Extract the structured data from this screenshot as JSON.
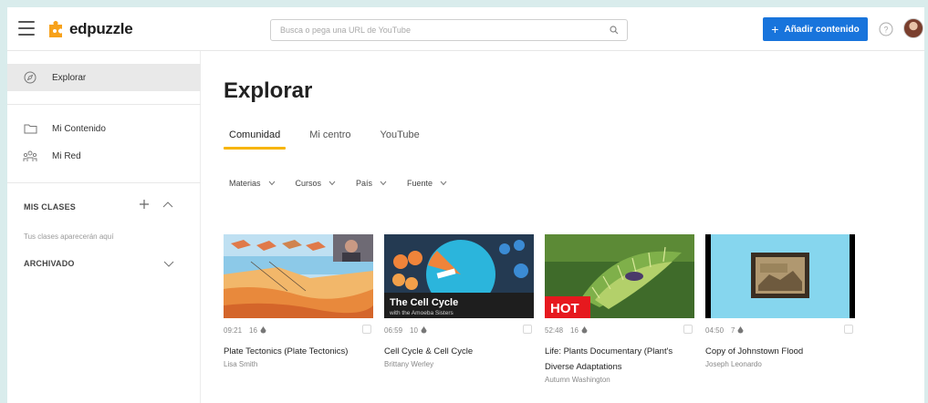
{
  "header": {
    "logo_text": "edpuzzle",
    "search_placeholder": "Busca o pega una URL de YouTube",
    "add_button_label": "Añadir contenido",
    "help_icon": "help-circle-icon"
  },
  "sidebar": {
    "items": [
      {
        "label": "Explorar",
        "icon": "compass-icon"
      },
      {
        "label": "Mi Contenido",
        "icon": "folder-icon"
      },
      {
        "label": "Mi Red",
        "icon": "network-icon"
      }
    ],
    "classes_header": "MIS CLASES",
    "classes_note": "Tus clases aparecerán aquí",
    "archived_header": "ARCHIVADO"
  },
  "main": {
    "title": "Explorar",
    "tabs": [
      {
        "label": "Comunidad",
        "active": true
      },
      {
        "label": "Mi centro",
        "active": false
      },
      {
        "label": "YouTube",
        "active": false
      }
    ],
    "filters": [
      {
        "label": "Materias"
      },
      {
        "label": "Cursos"
      },
      {
        "label": "País"
      },
      {
        "label": "Fuente"
      }
    ],
    "cards": [
      {
        "duration": "09:21",
        "questions": "16",
        "title": "Plate Tectonics (Plate Tectonics)",
        "author": "Lisa Smith"
      },
      {
        "duration": "06:59",
        "questions": "10",
        "title": "Cell Cycle & Cell Cycle",
        "author": "Brittany Werley",
        "thumb_title": "The Cell Cycle",
        "thumb_subtitle": "with the Amoeba Sisters"
      },
      {
        "duration": "52:48",
        "questions": "16",
        "title": "Life: Plants Documentary (Plant's Diverse Adaptations",
        "author": "Autumn Washington",
        "thumb_badge": "HOT"
      },
      {
        "duration": "04:50",
        "questions": "7",
        "title": "Copy of Johnstown Flood",
        "author": "Joseph Leonardo"
      }
    ]
  },
  "colors": {
    "primary_button": "#1874dc",
    "tab_underline": "#f7b500",
    "logo_orange": "#f7a11a"
  }
}
